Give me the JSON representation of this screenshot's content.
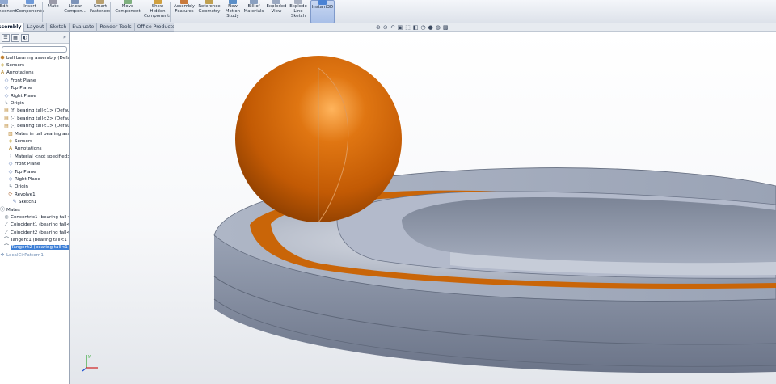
{
  "ribbon": {
    "buttons": [
      {
        "id": "edit-component",
        "lines": [
          "Edit",
          "Component"
        ],
        "icon": "edit-component-icon",
        "color": "#8fa8d0"
      },
      {
        "id": "insert-components",
        "lines": [
          "Insert",
          "Components"
        ],
        "icon": "insert-components-icon",
        "color": "#6f9ad8"
      },
      {
        "id": "mate",
        "lines": [
          "Mate"
        ],
        "icon": "mate-icon",
        "color": "#9a9aa8"
      },
      {
        "id": "linear-component-pattern",
        "lines": [
          "Linear",
          "Compon..."
        ],
        "icon": "linear-pattern-icon",
        "color": "#7d93b8"
      },
      {
        "id": "smart-fasteners",
        "lines": [
          "Smart",
          "Fasteners"
        ],
        "icon": "smart-fasteners-icon",
        "color": "#b8a070"
      },
      {
        "id": "move-component",
        "lines": [
          "Move",
          "Component"
        ],
        "icon": "move-component-icon",
        "color": "#7fb07f"
      },
      {
        "id": "show-hidden-components",
        "lines": [
          "Show",
          "Hidden",
          "Components"
        ],
        "icon": "show-hidden-icon",
        "color": "#d0a040"
      },
      {
        "id": "assembly-features",
        "lines": [
          "Assembly",
          "Features"
        ],
        "icon": "assembly-features-icon",
        "color": "#c97a3c"
      },
      {
        "id": "reference-geometry",
        "lines": [
          "Reference",
          "Geometry"
        ],
        "icon": "reference-geometry-icon",
        "color": "#c0a050"
      },
      {
        "id": "new-motion-study",
        "lines": [
          "New",
          "Motion",
          "Study"
        ],
        "icon": "motion-study-icon",
        "color": "#5b8fc8"
      },
      {
        "id": "bill-of-materials",
        "lines": [
          "Bill of",
          "Materials"
        ],
        "icon": "bill-of-materials-icon",
        "color": "#8aa0c0"
      },
      {
        "id": "exploded-view",
        "lines": [
          "Exploded",
          "View"
        ],
        "icon": "exploded-view-icon",
        "color": "#9aa8c0"
      },
      {
        "id": "explode-line-sketch",
        "lines": [
          "Explode",
          "Line",
          "Sketch"
        ],
        "icon": "explode-line-icon",
        "color": "#a8b0c0"
      },
      {
        "id": "instant3d",
        "lines": [
          "Instant3D"
        ],
        "icon": "instant3d-icon",
        "color": "#4a82d4"
      }
    ]
  },
  "tabs": [
    "Assembly",
    "Layout",
    "Sketch",
    "Evaluate",
    "Render Tools",
    "Office Products"
  ],
  "tree": [
    {
      "text": "ball bearing assembly  (Default<",
      "icon": "assembly-icon",
      "indent": 0
    },
    {
      "text": "Sensors",
      "icon": "sensors-icon",
      "indent": 0
    },
    {
      "text": "Annotations",
      "icon": "annotations-icon",
      "indent": 0
    },
    {
      "text": "Front Plane",
      "icon": "plane-icon",
      "indent": 1
    },
    {
      "text": "Top Plane",
      "icon": "plane-icon",
      "indent": 1
    },
    {
      "text": "Right Plane",
      "icon": "plane-icon",
      "indent": 1
    },
    {
      "text": "Origin",
      "icon": "origin-icon",
      "indent": 1
    },
    {
      "text": "(f) bearing tall<1> (Default<<",
      "icon": "part-icon",
      "indent": 1
    },
    {
      "text": "(-) bearing tall<2> (Default<<",
      "icon": "part-icon",
      "indent": 1
    },
    {
      "text": "(-) bearing tall<1> (Default<<",
      "icon": "part-icon",
      "indent": 1
    },
    {
      "text": "Mates in tall bearing ass",
      "icon": "mates-folder-icon",
      "indent": 2
    },
    {
      "text": "Sensors",
      "icon": "sensors-icon",
      "indent": 2
    },
    {
      "text": "Annotations",
      "icon": "annotations-icon",
      "indent": 2
    },
    {
      "text": "Material <not specified>",
      "icon": "material-icon",
      "indent": 2
    },
    {
      "text": "Front Plane",
      "icon": "plane-icon",
      "indent": 2
    },
    {
      "text": "Top Plane",
      "icon": "plane-icon",
      "indent": 2
    },
    {
      "text": "Right Plane",
      "icon": "plane-icon",
      "indent": 2
    },
    {
      "text": "Origin",
      "icon": "origin-icon",
      "indent": 2
    },
    {
      "text": "Revolve1",
      "icon": "revolve-icon",
      "indent": 2
    },
    {
      "text": "Sketch1",
      "icon": "sketch-icon",
      "indent": 3
    },
    {
      "text": "Mates",
      "icon": "mates-icon",
      "indent": 0
    },
    {
      "text": "Concentric1 (bearing tall<",
      "icon": "concentric-icon",
      "indent": 1
    },
    {
      "text": "Coincident1 (bearing tall<",
      "icon": "coincident-icon",
      "indent": 1
    },
    {
      "text": "Coincident2 (bearing tall<",
      "icon": "coincident-icon",
      "indent": 1
    },
    {
      "text": "Tangent1 (bearing tall<1",
      "icon": "tangent-icon",
      "indent": 1
    },
    {
      "text": "Tangent2 (bearing tall<1",
      "icon": "tangent-icon",
      "indent": 1,
      "selected": true
    },
    {
      "text": "LocalCirPattern1",
      "icon": "pattern-icon",
      "indent": 0,
      "faded": true
    }
  ],
  "colors": {
    "ball": "#c75f06",
    "ring": "#8f98ab",
    "groove": "#c96508",
    "selection": "#3d7fd6"
  }
}
